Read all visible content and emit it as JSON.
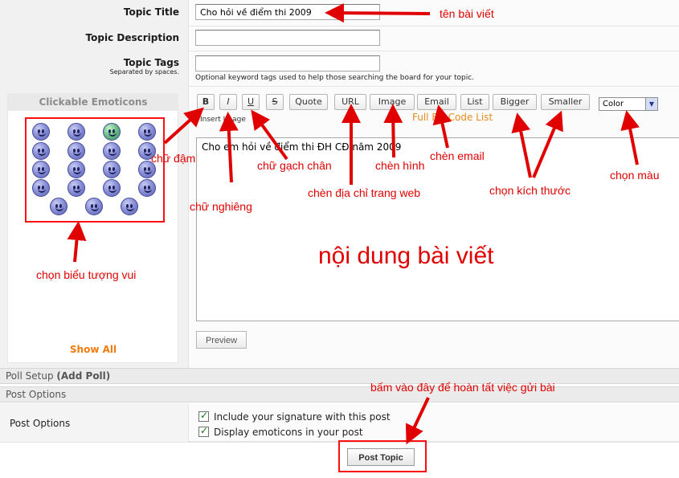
{
  "form": {
    "topic_title_label": "Topic Title",
    "topic_title_value": "Cho hỏi về điểm thi 2009",
    "topic_description_label": "Topic Description",
    "topic_description_value": "",
    "topic_tags_label": "Topic Tags",
    "topic_tags_sublabel": "Separated by spaces.",
    "topic_tags_value": "",
    "topic_tags_hint": "Optional keyword tags used to help those searching the board for your topic."
  },
  "emoticons": {
    "title": "Clickable Emoticons",
    "show_all": "Show All",
    "icons": [
      "smile-icon",
      "smile-icon",
      "alien-icon",
      "devil-icon",
      "smile-icon",
      "smile-icon",
      "cool-icon",
      "smile-icon",
      "smile-icon",
      "smile-icon",
      "smile-icon",
      "smile-icon",
      "smile-icon",
      "smile-icon",
      "smile-icon",
      "smile-icon",
      "smile-icon",
      "wink-icon",
      "smile-icon"
    ]
  },
  "toolbar": {
    "bold": "B",
    "italic": "I",
    "underline": "U",
    "strike": "S",
    "quote": "Quote",
    "url": "URL",
    "image": "Image",
    "email": "Email",
    "list": "List",
    "bigger": "Bigger",
    "smaller": "Smaller",
    "color": "Color",
    "insert_image": "Insert Image",
    "bbcode_link": "Full BB Code List"
  },
  "editor": {
    "content": "Cho em hỏi về điểm thi ĐH CĐ năm 2009",
    "preview": "Preview"
  },
  "poll": {
    "label": "Poll Setup",
    "add_poll": "(Add Poll)"
  },
  "post_options": {
    "section_title": "Post Options",
    "label": "Post Options",
    "include_signature": "Include your signature with this post",
    "display_emoticons": "Display emoticons in your post",
    "include_signature_checked": true,
    "display_emoticons_checked": true,
    "post_topic": "Post Topic"
  },
  "annotations": {
    "title": "tên bài viết",
    "bold": "chữ đậm",
    "italic": "chữ nghiêng",
    "underline": "chữ gạch chân",
    "url": "chèn địa chỉ trang web",
    "image": "chèn hình",
    "email": "chèn email",
    "size": "chọn kích thước",
    "color": "chọn màu",
    "emoticons": "chọn biểu tượng vui",
    "content": "nội dung bài viết",
    "submit": "bấm vào đây để hoàn tất việc gửi bài",
    "color_hex": "#e00000"
  }
}
